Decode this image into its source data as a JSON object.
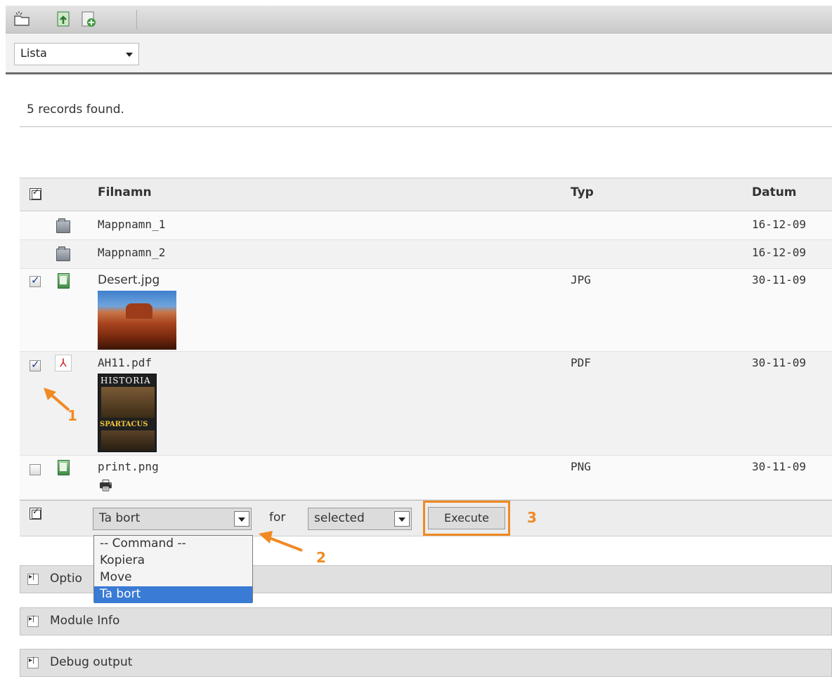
{
  "toolbar": {
    "icons": [
      "new-folder-icon",
      "upload-icon",
      "add-file-icon"
    ]
  },
  "view": {
    "selected": "Lista"
  },
  "status": {
    "records_text": "5 records found."
  },
  "table": {
    "columns": [
      "Filnamn",
      "Typ",
      "Datum"
    ],
    "rows": [
      {
        "name": "Mappnamn_1",
        "type": "",
        "date": "16-12-09",
        "icon": "folder-icon",
        "checked": false,
        "has_checkbox": false
      },
      {
        "name": "Mappnamn_2",
        "type": "",
        "date": "16-12-09",
        "icon": "folder-icon",
        "checked": false,
        "has_checkbox": false
      },
      {
        "name": "Desert.jpg",
        "type": "JPG",
        "date": "30-11-09",
        "icon": "image-file-icon",
        "checked": true,
        "has_checkbox": true
      },
      {
        "name": "AH11.pdf",
        "type": "PDF",
        "date": "30-11-09",
        "icon": "pdf-icon",
        "checked": true,
        "has_checkbox": true,
        "thumb_title": "HISTORIA",
        "thumb_caption": "SPARTACUS"
      },
      {
        "name": "print.png",
        "type": "PNG",
        "date": "30-11-09",
        "icon": "image-file-icon",
        "checked": false,
        "has_checkbox": true
      }
    ]
  },
  "actions": {
    "command_selected": "Ta bort",
    "for_label": "for",
    "target_selected": "selected",
    "execute_label": "Execute",
    "command_options": [
      "-- Command --",
      "Kopiera",
      "Move",
      "Ta bort"
    ]
  },
  "panels": {
    "options": "Optio",
    "module_info": "Module Info",
    "debug": "Debug output"
  },
  "annotations": {
    "n1": "1",
    "n2": "2",
    "n3": "3"
  },
  "colors": {
    "annotation": "#f08a24",
    "selection": "#3a7bd5"
  }
}
